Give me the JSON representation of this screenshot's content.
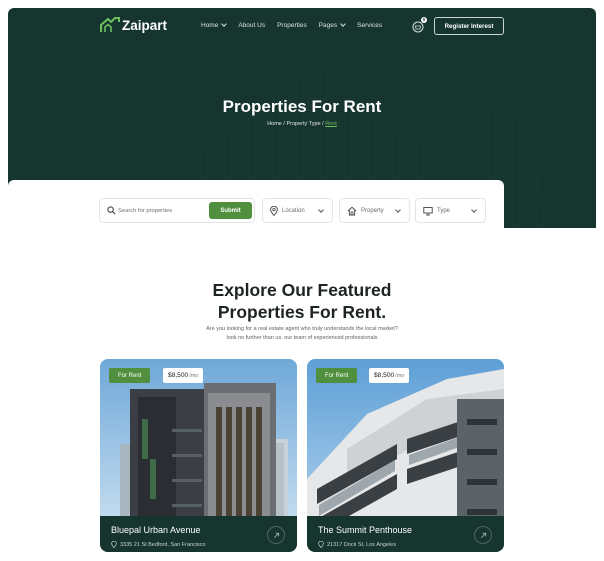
{
  "nav": {
    "logo": "Zaipart",
    "items": [
      {
        "label": "Home",
        "dropdown": true
      },
      {
        "label": "About Us",
        "dropdown": false
      },
      {
        "label": "Properties",
        "dropdown": false
      },
      {
        "label": "Pages",
        "dropdown": true
      },
      {
        "label": "Services",
        "dropdown": false
      }
    ],
    "cart_count": "0",
    "register_label": "Register Interest"
  },
  "hero": {
    "title": "Properties For Rent",
    "breadcrumb": {
      "home": "Home",
      "sep1": " / ",
      "type": "Property Type",
      "sep2": " / ",
      "current": "Rent"
    }
  },
  "search": {
    "placeholder": "Search for properties",
    "submit_label": "Submit",
    "filters": [
      {
        "label": "Location",
        "icon": "location-pin-icon"
      },
      {
        "label": "Property",
        "icon": "home-icon"
      },
      {
        "label": "Type",
        "icon": "monitor-icon"
      }
    ]
  },
  "featured": {
    "title_line1": "Explore Our Featured",
    "title_line2": "Properties For Rent.",
    "desc_line1": "Are you looking for a real estate agent who truly understands the local market?",
    "desc_line2": "look no further than us. our team of experienced professionals"
  },
  "cards": [
    {
      "tag": "For Rent",
      "price": "$8,500",
      "price_unit": "/mo",
      "name": "Bluepal Urban Avenue",
      "address": "3335 21 St Bedford, San Francisco"
    },
    {
      "tag": "For Rent",
      "price": "$8,500",
      "price_unit": "/mo",
      "name": "The Summit Penthouse",
      "address": "21317 Dock St, Los Angeles"
    }
  ],
  "colors": {
    "brand_dark": "#17352f",
    "accent_green": "#4f8f3d",
    "link_green": "#6cbf61"
  }
}
